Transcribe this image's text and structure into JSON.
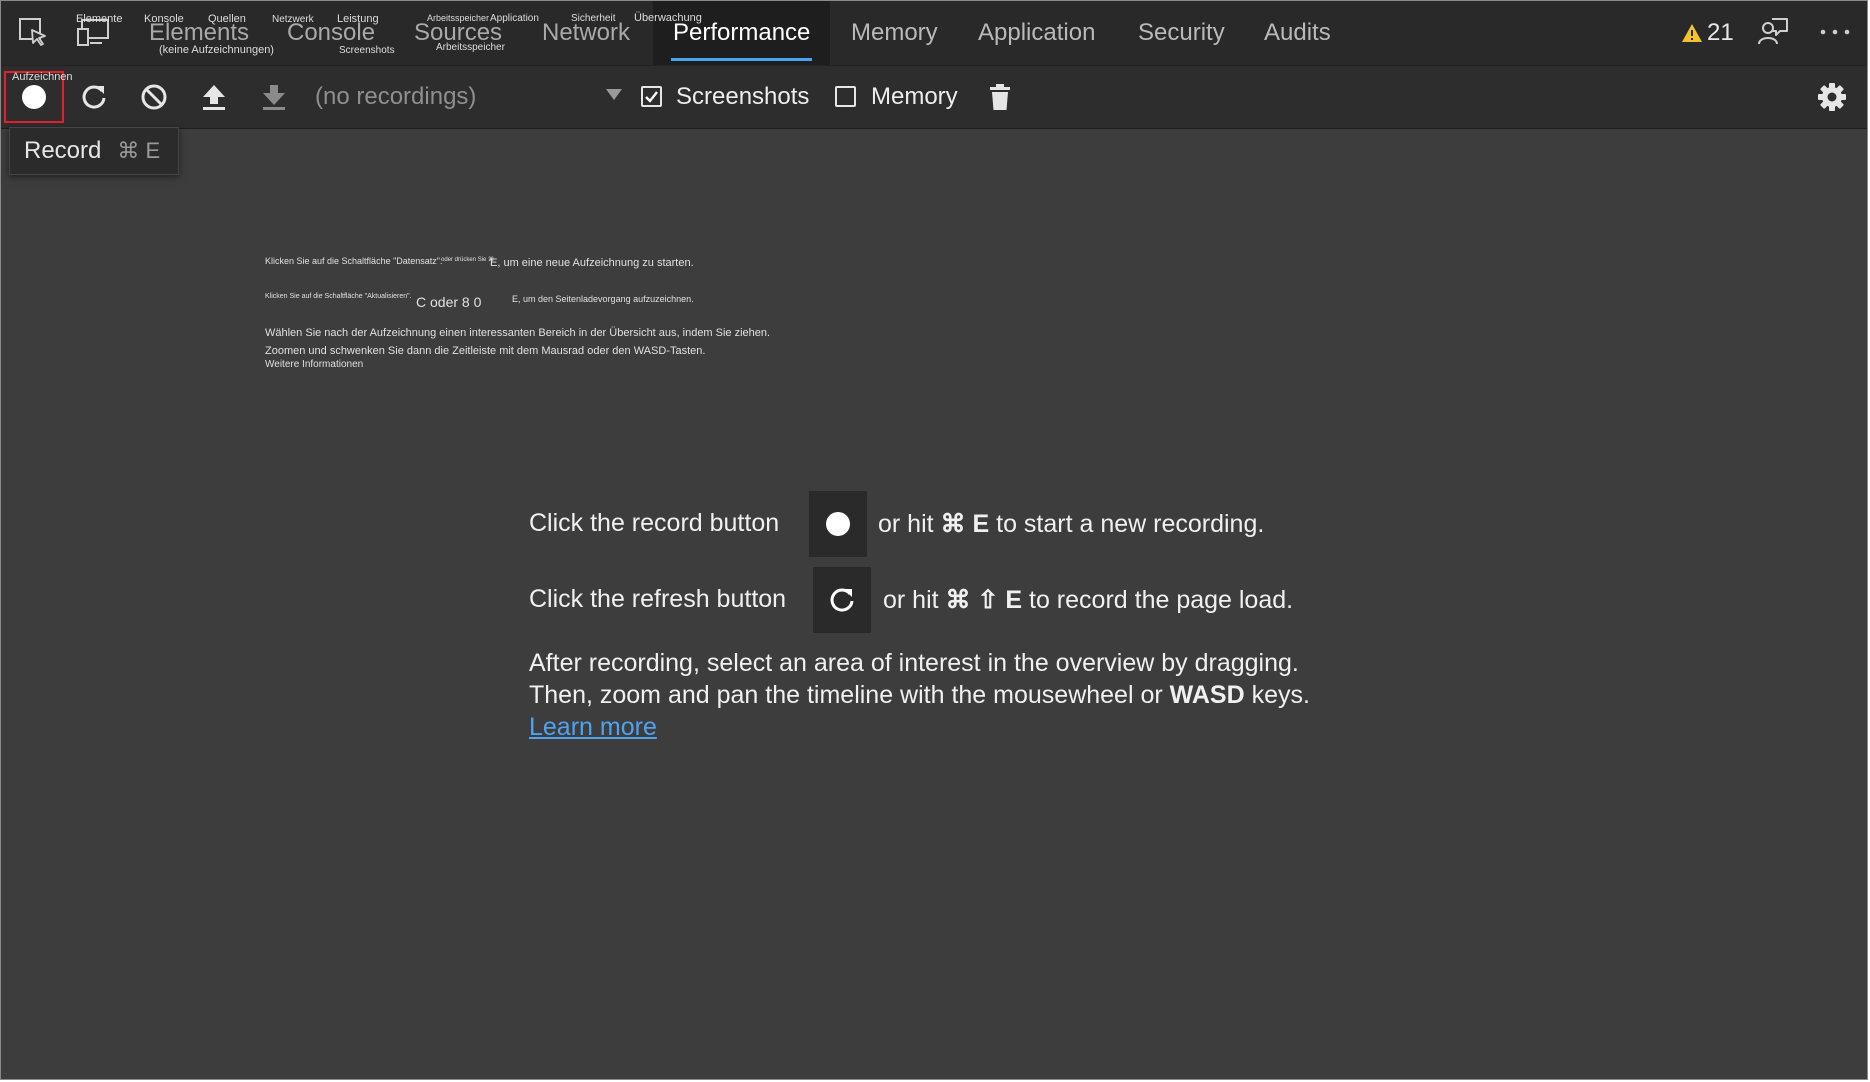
{
  "tabs": {
    "items": [
      {
        "label": "Elements",
        "overlay": "Elemente",
        "sub": "(keine Aufzeichnungen)"
      },
      {
        "label": "Console",
        "overlay": "Konsole",
        "overlay2": "Quellen",
        "sub": "Screenshots"
      },
      {
        "label": "Sources",
        "overlay": "Netzwerk",
        "overlay2": "Leistung"
      },
      {
        "label": "Network",
        "overlay": "Arbeitsspeicher",
        "overlay2": "Application",
        "sub": "Arbeitsspeicher"
      },
      {
        "label": "Performance",
        "overlay": "Sicherheit",
        "overlay2": "Überwachung"
      },
      {
        "label": "Memory"
      },
      {
        "label": "Application"
      },
      {
        "label": "Security"
      },
      {
        "label": "Audits"
      }
    ],
    "active": "Performance",
    "warning_count": "21"
  },
  "toolbar": {
    "record_overlay": "Aufzeichnen",
    "recordings_placeholder": "(no recordings)",
    "screenshots_label": "Screenshots",
    "screenshots_checked": true,
    "memory_label": "Memory",
    "memory_checked": false
  },
  "tooltip": {
    "label": "Record",
    "shortcut": "⌘ E"
  },
  "overlay_text": {
    "line1a": "Klicken Sie auf die Schaltfläche \"Datensatz\".",
    "line1b": "oder drücken Sie ⌘",
    "line1c": "E, um eine neue Aufzeichnung zu starten.",
    "line2a": "Klicken Sie auf die Schaltfläche \"Aktualisieren\".",
    "line2b": "C oder 8 0",
    "line2c": "E, um den Seitenladevorgang aufzuzeichnen.",
    "line3": "Wählen Sie nach der Aufzeichnung einen interessanten Bereich in der Übersicht aus, indem Sie ziehen.",
    "line4": "Zoomen und schwenken Sie dann die Zeitleiste mit dem Mausrad oder den WASD-Tasten.",
    "line5": "Weitere Informationen"
  },
  "instructions": {
    "record_prefix": "Click the record button",
    "record_suffix_a": "or hit",
    "record_key": "⌘ E",
    "record_suffix_b": "to start a new recording.",
    "refresh_prefix": "Click the refresh button",
    "refresh_suffix_a": "or hit",
    "refresh_key": "⌘ ⇧ E",
    "refresh_suffix_b": "to record the page load.",
    "after_line1": "After recording, select an area of interest in the overview by dragging.",
    "after_line2_a": "Then, zoom and pan the timeline with the mousewheel or",
    "after_line2_key": "WASD",
    "after_line2_b": "keys.",
    "learn_more": "Learn more"
  },
  "colors": {
    "background": "#3d3d3d",
    "tabbar": "#292929",
    "toolbar": "#2d2d2d",
    "accent": "#4aa3f0",
    "highlight": "#e0212e",
    "warning": "#f2c12e"
  }
}
